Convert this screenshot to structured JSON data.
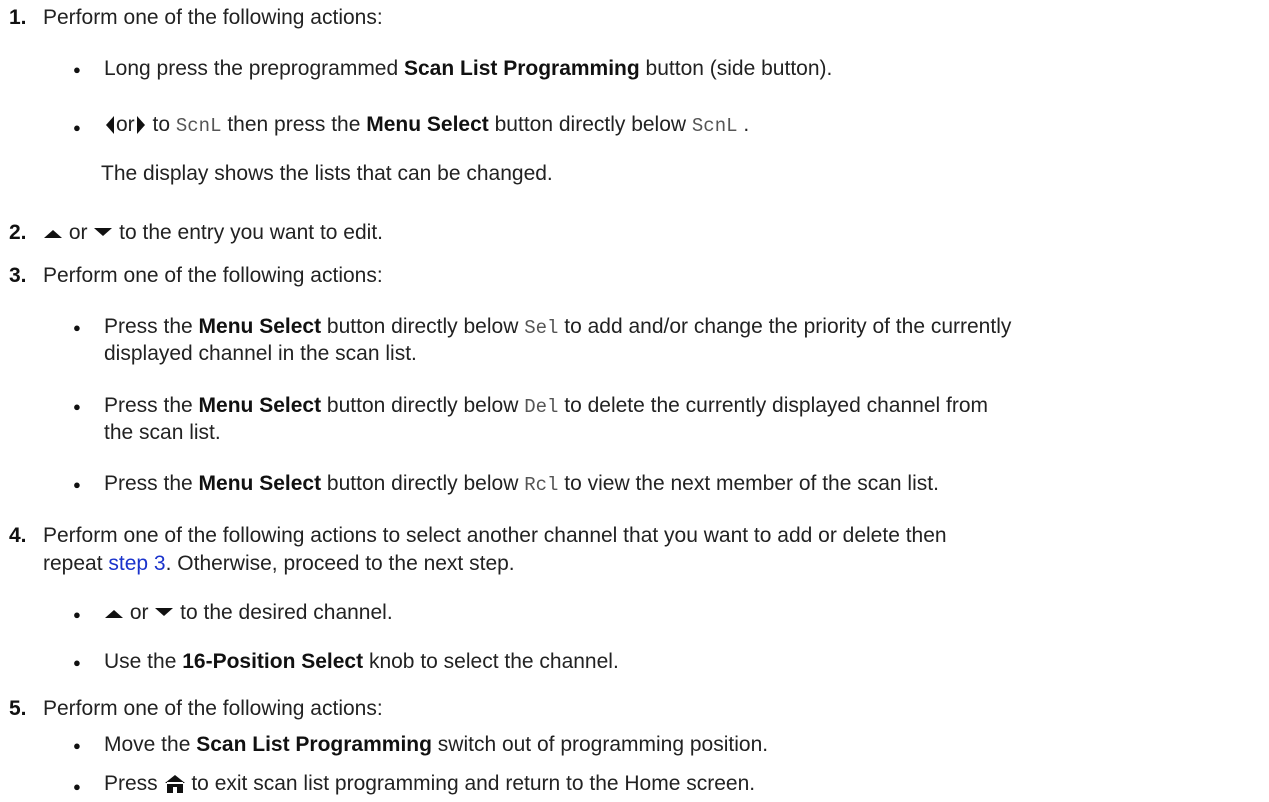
{
  "steps": [
    {
      "num": "1.",
      "text": "Perform one of the following actions:",
      "bullets": [
        {
          "pre": "Long press the preprogrammed ",
          "bold": "Scan List Programming",
          "post": " button (side button)."
        },
        {
          "or": "or",
          "to": " to ",
          "code1": "ScnL",
          "mid": " then press the ",
          "bold": "Menu Select",
          "post": " button directly below ",
          "code2": "ScnL",
          "end": " ."
        }
      ],
      "note": "The display shows the lists that can be changed."
    },
    {
      "num": "2.",
      "or": " or ",
      "text": " to the entry you want to edit."
    },
    {
      "num": "3.",
      "text": "Perform one of the following actions:",
      "bullets": [
        {
          "pre": "Press the ",
          "bold": "Menu Select",
          "post": " button directly below ",
          "code": "Sel",
          "line1": " to add and/or change the priority of the currently",
          "line2": "displayed channel in the scan list."
        },
        {
          "pre": "Press the ",
          "bold": "Menu Select",
          "post": " button directly below ",
          "code": "Del",
          "line1": " to delete the currently displayed channel from",
          "line2": "the scan list."
        },
        {
          "pre": "Press the ",
          "bold": "Menu Select",
          "post": " button directly below ",
          "code": "Rcl",
          "line1": " to view the next member of the scan list."
        }
      ]
    },
    {
      "num": "4.",
      "line1": "Perform one of the following actions to select another channel that you want to add or delete then",
      "line2_pre": "repeat ",
      "link": "step 3",
      "line2_post": ". Otherwise, proceed to the next step.",
      "bullets": [
        {
          "or": " or ",
          "post": " to the desired channel."
        },
        {
          "pre": "Use the ",
          "bold": "16-Position Select",
          "post": " knob to select the channel."
        }
      ]
    },
    {
      "num": "5.",
      "text": "Perform one of the following actions:",
      "bullets": [
        {
          "pre": "Move the ",
          "bold": "Scan List Programming",
          "post": " switch out of programming position."
        },
        {
          "pre": "Press ",
          "post": " to exit scan list programming and return to the Home screen."
        }
      ]
    }
  ],
  "icons": {
    "left": "left-arrow-icon",
    "right": "right-arrow-icon",
    "up": "up-arrow-icon",
    "down": "down-arrow-icon",
    "home": "home-icon"
  },
  "colors": {
    "link": "#1a33cc"
  }
}
